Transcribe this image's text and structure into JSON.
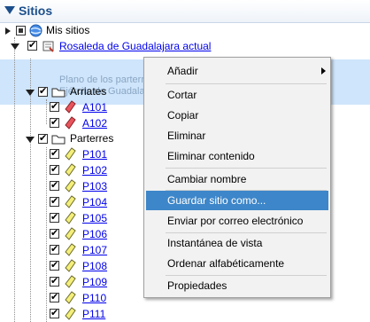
{
  "panel": {
    "title": "Sitios"
  },
  "tree": {
    "root_label": "Mis sitios",
    "site_name": "Rosaleda de Guadalajara actual",
    "site_description": "Plano de los parterres de la rosaleda de la Avenida del Ejército de Guadalajara",
    "groups": [
      {
        "label": "Arriates",
        "items": [
          "A101",
          "A102"
        ]
      },
      {
        "label": "Parterres",
        "items": [
          "P101",
          "P102",
          "P103",
          "P104",
          "P105",
          "P106",
          "P107",
          "P108",
          "P109",
          "P110",
          "P111"
        ]
      }
    ]
  },
  "context_menu": {
    "items": [
      "Añadir",
      "Cortar",
      "Copiar",
      "Eliminar",
      "Eliminar contenido",
      "Cambiar nombre",
      "Guardar sitio como...",
      "Enviar por correo electrónico",
      "Instantánea de vista",
      "Ordenar alfabéticamente",
      "Propiedades"
    ],
    "highlighted": "Guardar sitio como..."
  },
  "colors": {
    "arriate_icon": "#e8545c",
    "parterre_icon": "#f4ef7a",
    "highlight": "#3d86c9",
    "selection": "#cfe5fb"
  }
}
